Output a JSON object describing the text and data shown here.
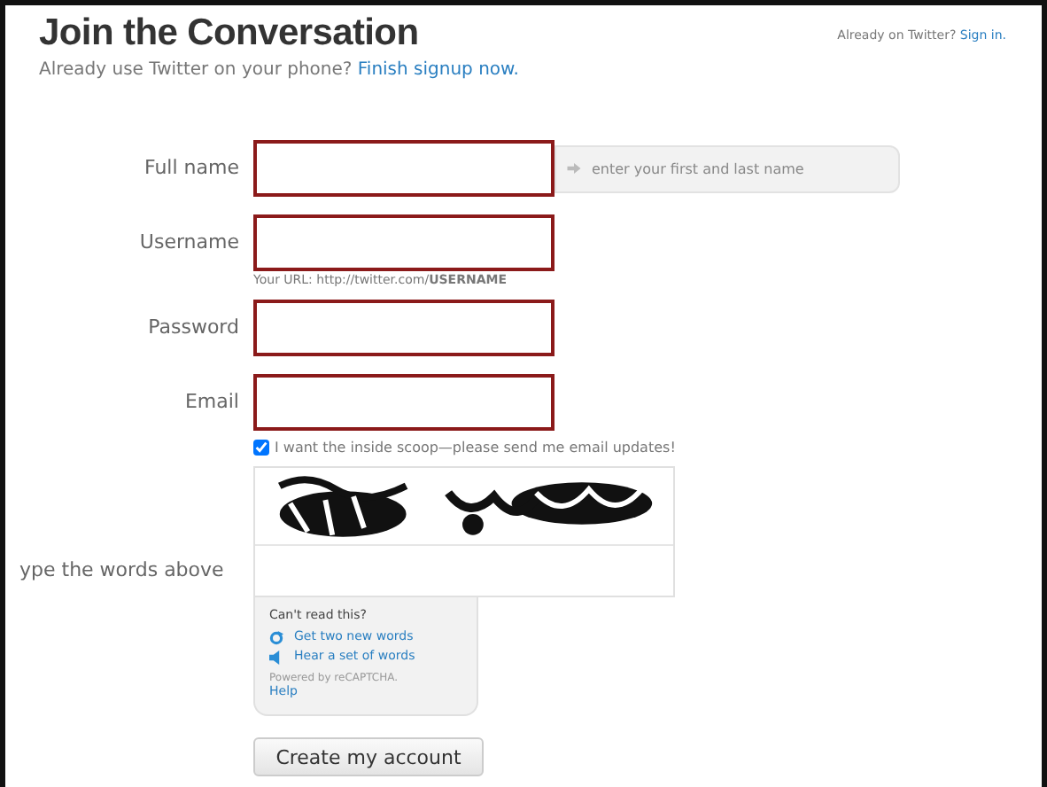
{
  "header": {
    "title": "Join the Conversation",
    "subtitle": "Already use Twitter on your phone?",
    "subtitle_link": "Finish signup now.",
    "signin_text": "Already on Twitter?",
    "signin_link": "Sign in."
  },
  "fields": [
    {
      "label": "Full name",
      "hint": "enter your first and last name"
    },
    {
      "label": "Username",
      "note_prefix": "Your URL: http://twitter.com/",
      "note_bold": "USERNAME"
    },
    {
      "label": "Password"
    },
    {
      "label": "Email"
    }
  ],
  "updates_checkbox": {
    "label": "I want the inside scoop—please send me email updates!",
    "checked": true
  },
  "captcha": {
    "label": "ype the words above",
    "help_title": "Can't read this?",
    "links": [
      {
        "kind": "refresh",
        "text": "Get two new words"
      },
      {
        "kind": "audio",
        "text": "Hear a set of words"
      }
    ],
    "powered": "Powered by reCAPTCHA.",
    "help": "Help"
  },
  "submit": "Create my account"
}
